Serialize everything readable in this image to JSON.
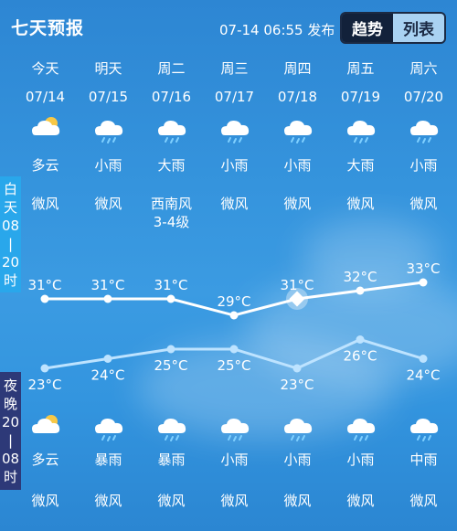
{
  "header": {
    "title": "七天预报",
    "publish_time": "07-14 06:55 发布",
    "tabs": [
      {
        "label": "趋势",
        "active": true
      },
      {
        "label": "列表",
        "active": false
      }
    ]
  },
  "sidebar": {
    "day_label": [
      "白",
      "天",
      "08",
      "|",
      "20",
      "时"
    ],
    "night_label": [
      "夜",
      "晚",
      "20",
      "|",
      "08",
      "时"
    ]
  },
  "days": [
    {
      "weekday": "今天",
      "date": "07/14",
      "day_icon": "partly-cloudy-sun-icon",
      "day_weather": "多云",
      "day_wind": "微风",
      "day_wind_level": "",
      "night_icon": "partly-cloudy-sun-icon",
      "night_weather": "多云",
      "night_wind": "微风"
    },
    {
      "weekday": "明天",
      "date": "07/15",
      "day_icon": "rain-cloud-icon",
      "day_weather": "小雨",
      "day_wind": "微风",
      "day_wind_level": "",
      "night_icon": "rain-cloud-icon",
      "night_weather": "暴雨",
      "night_wind": "微风"
    },
    {
      "weekday": "周二",
      "date": "07/16",
      "day_icon": "rain-cloud-icon",
      "day_weather": "大雨",
      "day_wind": "西南风",
      "day_wind_level": "3-4级",
      "night_icon": "rain-cloud-icon",
      "night_weather": "暴雨",
      "night_wind": "微风"
    },
    {
      "weekday": "周三",
      "date": "07/17",
      "day_icon": "rain-cloud-icon",
      "day_weather": "小雨",
      "day_wind": "微风",
      "day_wind_level": "",
      "night_icon": "rain-cloud-icon",
      "night_weather": "小雨",
      "night_wind": "微风"
    },
    {
      "weekday": "周四",
      "date": "07/18",
      "day_icon": "rain-cloud-icon",
      "day_weather": "小雨",
      "day_wind": "微风",
      "day_wind_level": "",
      "night_icon": "rain-cloud-icon",
      "night_weather": "小雨",
      "night_wind": "微风"
    },
    {
      "weekday": "周五",
      "date": "07/19",
      "day_icon": "rain-cloud-icon",
      "day_weather": "大雨",
      "day_wind": "微风",
      "day_wind_level": "",
      "night_icon": "rain-cloud-icon",
      "night_weather": "小雨",
      "night_wind": "微风"
    },
    {
      "weekday": "周六",
      "date": "07/20",
      "day_icon": "rain-cloud-icon",
      "day_weather": "小雨",
      "day_wind": "微风",
      "day_wind_level": "",
      "night_icon": "rain-cloud-icon",
      "night_weather": "中雨",
      "night_wind": "微风"
    }
  ],
  "temps": {
    "high_labels": [
      "31°C",
      "31°C",
      "31°C",
      "29°C",
      "31°C",
      "32°C",
      "33°C"
    ],
    "low_labels": [
      "23°C",
      "24°C",
      "25°C",
      "25°C",
      "23°C",
      "26°C",
      "24°C"
    ],
    "high_color": "#ffffff",
    "low_color": "#bde3ff"
  },
  "chart_data": {
    "type": "line",
    "x": [
      "07/14",
      "07/15",
      "07/16",
      "07/17",
      "07/18",
      "07/19",
      "07/20"
    ],
    "series": [
      {
        "values": [
          31,
          31,
          31,
          29,
          31,
          32,
          33
        ]
      },
      {
        "values": [
          23,
          24,
          25,
          25,
          23,
          26,
          24
        ]
      }
    ],
    "highlight_index": 4
  }
}
